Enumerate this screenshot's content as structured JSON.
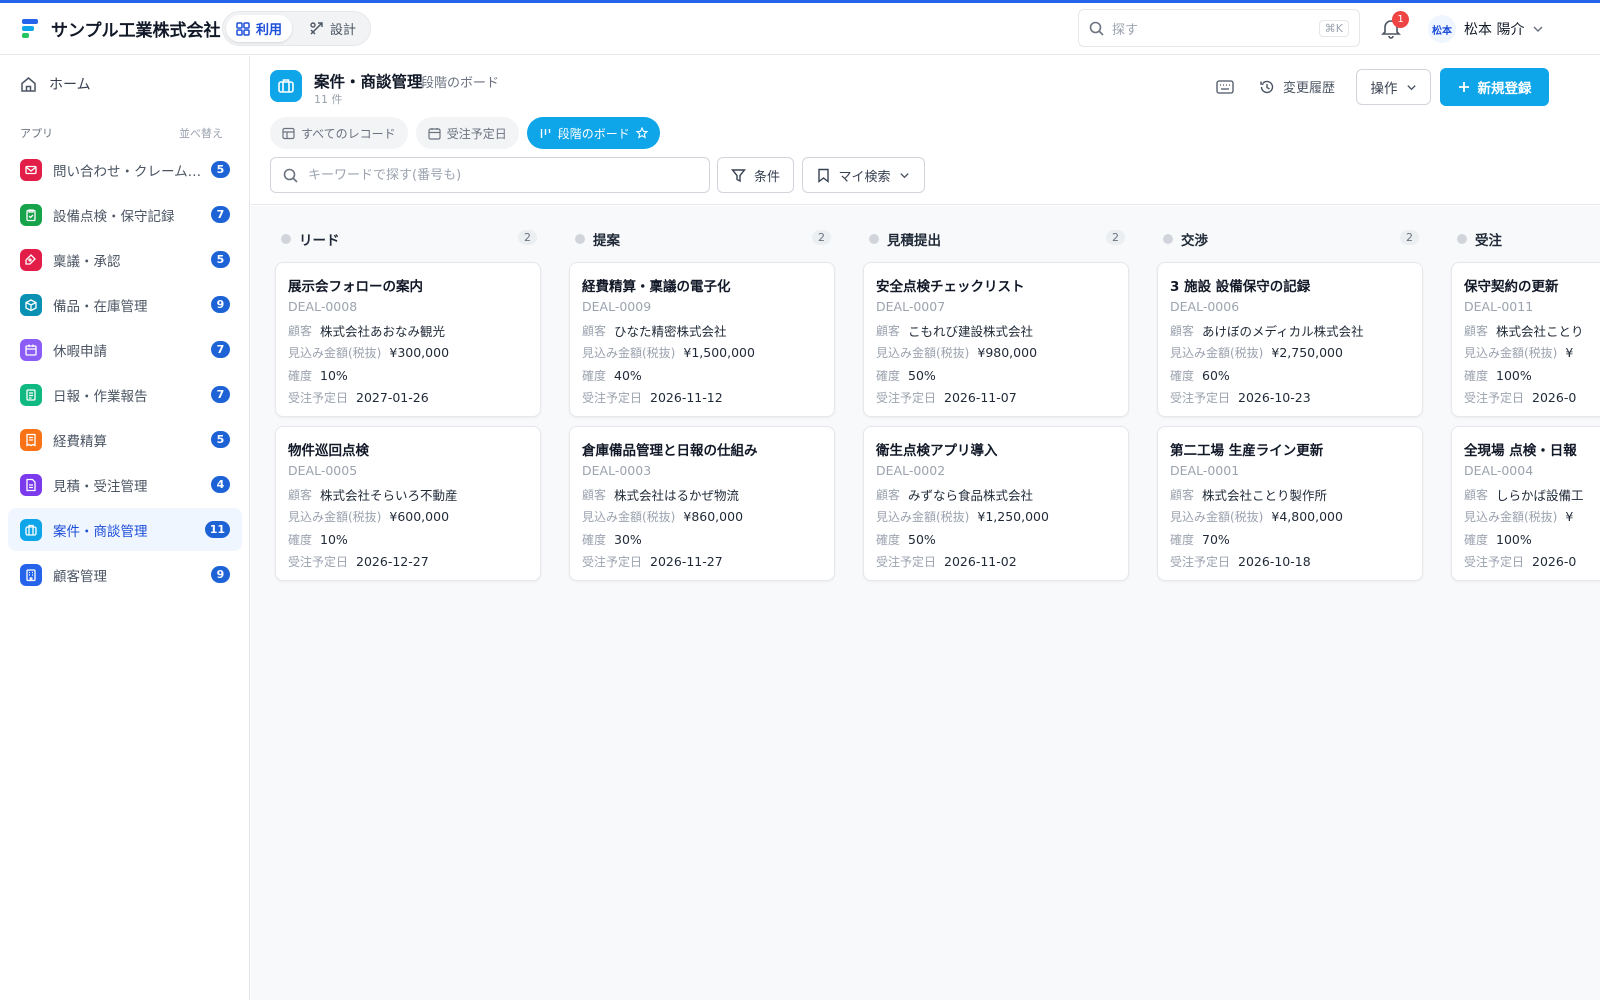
{
  "colors": {
    "accent": "#0ea5e9",
    "primary": "#1d4ed8",
    "badge": "#1e63d6",
    "notification": "#ef4444"
  },
  "header": {
    "company": "サンプル工業株式会社",
    "modes": [
      {
        "label": "利用",
        "icon": "grid-icon",
        "active": true
      },
      {
        "label": "設計",
        "icon": "tools-icon",
        "active": false
      }
    ],
    "search_placeholder": "探す",
    "shortcut": "⌘K",
    "notification_count": "1",
    "user_avatar": "松本",
    "user_name": "松本 陽介"
  },
  "sidebar": {
    "home": "ホーム",
    "apps_label": "アプリ",
    "sort_label": "並べ替え",
    "items": [
      {
        "label": "問い合わせ・クレーム管理",
        "count": "5",
        "color": "#e11d48",
        "icon": "mail-icon",
        "active": false
      },
      {
        "label": "設備点検・保守記録",
        "count": "7",
        "color": "#16a34a",
        "icon": "clipboard-icon",
        "active": false
      },
      {
        "label": "稟議・承認",
        "count": "5",
        "color": "#e11d48",
        "icon": "stamp-icon",
        "active": false
      },
      {
        "label": "備品・在庫管理",
        "count": "9",
        "color": "#0891b2",
        "icon": "box-icon",
        "active": false
      },
      {
        "label": "休暇申請",
        "count": "7",
        "color": "#8b5cf6",
        "icon": "calendar-icon",
        "active": false
      },
      {
        "label": "日報・作業報告",
        "count": "7",
        "color": "#10b981",
        "icon": "report-icon",
        "active": false
      },
      {
        "label": "経費精算",
        "count": "5",
        "color": "#f97316",
        "icon": "receipt-icon",
        "active": false
      },
      {
        "label": "見積・受注管理",
        "count": "4",
        "color": "#7c3aed",
        "icon": "document-icon",
        "active": false
      },
      {
        "label": "案件・商談管理",
        "count": "11",
        "color": "#0ea5e9",
        "icon": "briefcase-icon",
        "active": true
      },
      {
        "label": "顧客管理",
        "count": "9",
        "color": "#2563eb",
        "icon": "building-icon",
        "active": false
      }
    ]
  },
  "page": {
    "title": "案件・商談管理",
    "subtitle": "段階のボード",
    "count": "11 件",
    "history": "変更履歴",
    "ops": "操作",
    "new": "新規登録",
    "views": [
      {
        "label": "すべてのレコード",
        "icon": "table-icon",
        "active": false
      },
      {
        "label": "受注予定日",
        "icon": "calendar-icon",
        "active": false
      },
      {
        "label": "段階のボード",
        "icon": "board-icon",
        "active": true
      }
    ],
    "search_placeholder": "キーワードで探す(番号も)",
    "conditions": "条件",
    "my_search": "マイ検索"
  },
  "field_labels": {
    "customer": "顧客",
    "amount": "見込み金額(税抜)",
    "probability": "確度",
    "date": "受注予定日"
  },
  "board": {
    "columns": [
      {
        "name": "リード",
        "count": "2",
        "cards": [
          {
            "title": "展示会フォローの案内",
            "id": "DEAL-0008",
            "customer": "株式会社あおなみ観光",
            "amount": "¥300,000",
            "probability": "10%",
            "date": "2027-01-26"
          },
          {
            "title": "物件巡回点検",
            "id": "DEAL-0005",
            "customer": "株式会社そらいろ不動産",
            "amount": "¥600,000",
            "probability": "10%",
            "date": "2026-12-27"
          }
        ]
      },
      {
        "name": "提案",
        "count": "2",
        "cards": [
          {
            "title": "経費精算・稟議の電子化",
            "id": "DEAL-0009",
            "customer": "ひなた精密株式会社",
            "amount": "¥1,500,000",
            "probability": "40%",
            "date": "2026-11-12"
          },
          {
            "title": "倉庫備品管理と日報の仕組み",
            "id": "DEAL-0003",
            "customer": "株式会社はるかぜ物流",
            "amount": "¥860,000",
            "probability": "30%",
            "date": "2026-11-27"
          }
        ]
      },
      {
        "name": "見積提出",
        "count": "2",
        "cards": [
          {
            "title": "安全点検チェックリスト",
            "id": "DEAL-0007",
            "customer": "こもれび建設株式会社",
            "amount": "¥980,000",
            "probability": "50%",
            "date": "2026-11-07"
          },
          {
            "title": "衛生点検アプリ導入",
            "id": "DEAL-0002",
            "customer": "みずなら食品株式会社",
            "amount": "¥1,250,000",
            "probability": "50%",
            "date": "2026-11-02"
          }
        ]
      },
      {
        "name": "交渉",
        "count": "2",
        "cards": [
          {
            "title": "3 施設 設備保守の記録",
            "id": "DEAL-0006",
            "customer": "あけぼのメディカル株式会社",
            "amount": "¥2,750,000",
            "probability": "60%",
            "date": "2026-10-23"
          },
          {
            "title": "第二工場 生産ライン更新",
            "id": "DEAL-0001",
            "customer": "株式会社ことり製作所",
            "amount": "¥4,800,000",
            "probability": "70%",
            "date": "2026-10-18"
          }
        ]
      },
      {
        "name": "受注",
        "count": "",
        "cards": [
          {
            "title": "保守契約の更新",
            "id": "DEAL-0011",
            "customer": "株式会社ことり",
            "amount": "¥",
            "probability": "100%",
            "date": "2026-0"
          },
          {
            "title": "全現場 点検・日報",
            "id": "DEAL-0004",
            "customer": "しらかば設備工",
            "amount": "¥",
            "probability": "100%",
            "date": "2026-0"
          }
        ]
      }
    ]
  }
}
